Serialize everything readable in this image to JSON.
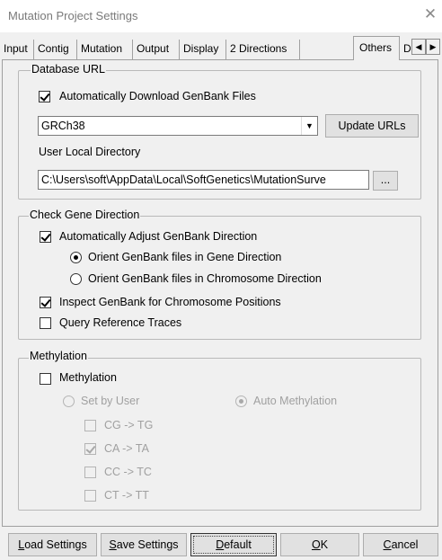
{
  "window": {
    "title": "Mutation Project Settings",
    "close_glyph": "✕"
  },
  "tabs": [
    "Input",
    "Contig",
    "Mutation",
    "Output",
    "Display",
    "2 Directions",
    "Others",
    "D"
  ],
  "tab_scroll_glyph": "◀",
  "database_url": {
    "group_label": "Database URL",
    "auto_download_label": "Automatically Download GenBank Files",
    "auto_download_checked": true,
    "genome_select_value": "GRCh38",
    "update_urls_label": "Update URLs",
    "local_dir_label": "User Local Directory",
    "local_dir_value": "C:\\Users\\soft\\AppData\\Local\\SoftGenetics\\MutationSurve",
    "browse_label": "..."
  },
  "gene_direction": {
    "group_label": "Check Gene Direction",
    "auto_adjust_label": "Automatically Adjust GenBank Direction",
    "auto_adjust_checked": true,
    "orient_gene_label": "Orient GenBank files in Gene Direction",
    "orient_gene_selected": true,
    "orient_chrom_label": "Orient GenBank files in Chromosome Direction",
    "inspect_label": "Inspect GenBank for Chromosome Positions",
    "inspect_checked": true,
    "query_label": "Query Reference Traces",
    "query_checked": false
  },
  "methylation": {
    "group_label": "Methylation",
    "methylation_label": "Methylation",
    "methylation_checked": false,
    "set_by_user_label": "Set by User",
    "auto_methylation_label": "Auto Methylation",
    "auto_methylation_selected": true,
    "conversions": [
      {
        "label": "CG -> TG",
        "checked": false
      },
      {
        "label": "CA -> TA",
        "checked": true
      },
      {
        "label": "CC -> TC",
        "checked": false
      },
      {
        "label": "CT -> TT",
        "checked": false
      }
    ]
  },
  "footer": {
    "load_label": "Load Settings",
    "save_label": "Save Settings",
    "default_label": "Default",
    "ok_label": "OK",
    "cancel_label": "Cancel"
  }
}
